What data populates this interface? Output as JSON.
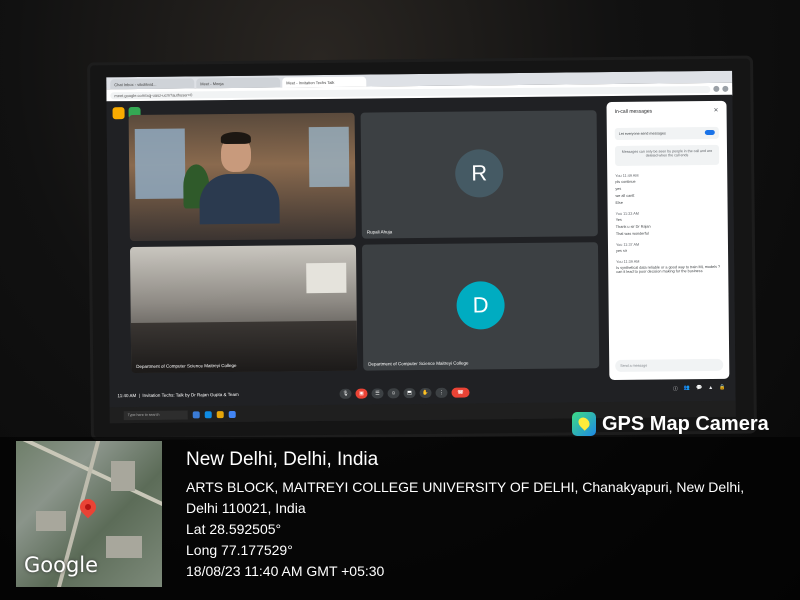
{
  "browser": {
    "tabs": [
      "Chat Inbox - vikolikvid...",
      "Meet - Meeja",
      "Meet - Invitation Techs Talk"
    ],
    "url": "meet.google.com/xqj-uasz-ucm?authuser=0"
  },
  "meet": {
    "participants": [
      {
        "name": "",
        "type": "video"
      },
      {
        "name": "Rupali Ahuja",
        "initial": "R",
        "color": "#455a64"
      },
      {
        "name": "Department of Computer Science Maitreyi College",
        "type": "video"
      },
      {
        "name": "Department of Computer Science Maitreyi College",
        "initial": "D",
        "color": "#00acc1"
      }
    ],
    "bottom": {
      "time": "11:40 AM",
      "meeting_title": "Invitation Techs: Talk by Dr Rajan Gupta & Team"
    }
  },
  "chat": {
    "title": "In-call messages",
    "toggle_label": "Let everyone send messages",
    "notice": "Messages can only be seen by people in the call and are deleted when the call ends",
    "input_placeholder": "Send a message",
    "messages": [
      {
        "who": "You 11:49 AM",
        "lines": [
          "pls continue",
          "yes",
          "we all cantt",
          "Else"
        ]
      },
      {
        "who": "You 11:33 AM",
        "lines": [
          "Yes",
          "Thank u sir Dr Rajan",
          "That was wonderful"
        ]
      },
      {
        "who": "You 11:37 AM",
        "lines": [
          "yes sir"
        ]
      },
      {
        "who": "You 11:39 AM",
        "lines": [
          "Is synthetical data reliable or a good way to train ML models ? can it lead to poor decision making for the business"
        ]
      }
    ]
  },
  "taskbar": {
    "search_placeholder": "Type here to search"
  },
  "gps": {
    "brand": "GPS Map Camera",
    "map_logo": "Google",
    "city": "New Delhi, Delhi, India",
    "address_line1": "ARTS BLOCK, MAITREYI COLLEGE UNIVERSITY OF DELHI, Chanakyapuri, New Delhi,",
    "address_line2": "Delhi 110021, India",
    "lat": "Lat 28.592505°",
    "long": "Long 77.177529°",
    "datetime": "18/08/23 11:40 AM GMT +05:30"
  }
}
